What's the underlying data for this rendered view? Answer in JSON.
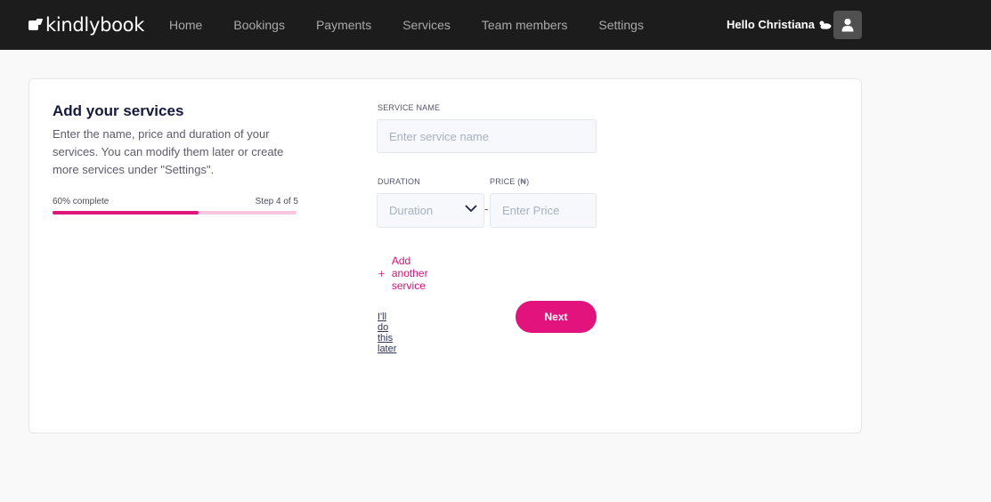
{
  "brand": {
    "name": "kindlybook"
  },
  "nav": {
    "items": [
      {
        "label": "Home"
      },
      {
        "label": "Bookings"
      },
      {
        "label": "Payments"
      },
      {
        "label": "Services"
      },
      {
        "label": "Team members"
      },
      {
        "label": "Settings"
      }
    ]
  },
  "user": {
    "greeting": "Hello Christiana"
  },
  "onboarding": {
    "title": "Add your services",
    "description": "Enter the name, price and duration of your services. You can modify them later or create more services under \"Settings\".",
    "progress_label": "60% complete",
    "step_label": "Step 4 of 5",
    "progress": 0.6
  },
  "form": {
    "service_name_label": "SERVICE NAME",
    "service_name_placeholder": "Enter service name",
    "duration_label": "DURATION",
    "duration_value": "Duration",
    "price_label": "PRICE (₦)",
    "price_placeholder": "Enter Price",
    "separator": "-",
    "add_another": "Add another service",
    "skip_label": "I'll do this later",
    "next_label": "Next"
  },
  "colors": {
    "accent": "#e3137d",
    "topbar": "#1c1c1c",
    "progress_track": "#f8c6de"
  }
}
